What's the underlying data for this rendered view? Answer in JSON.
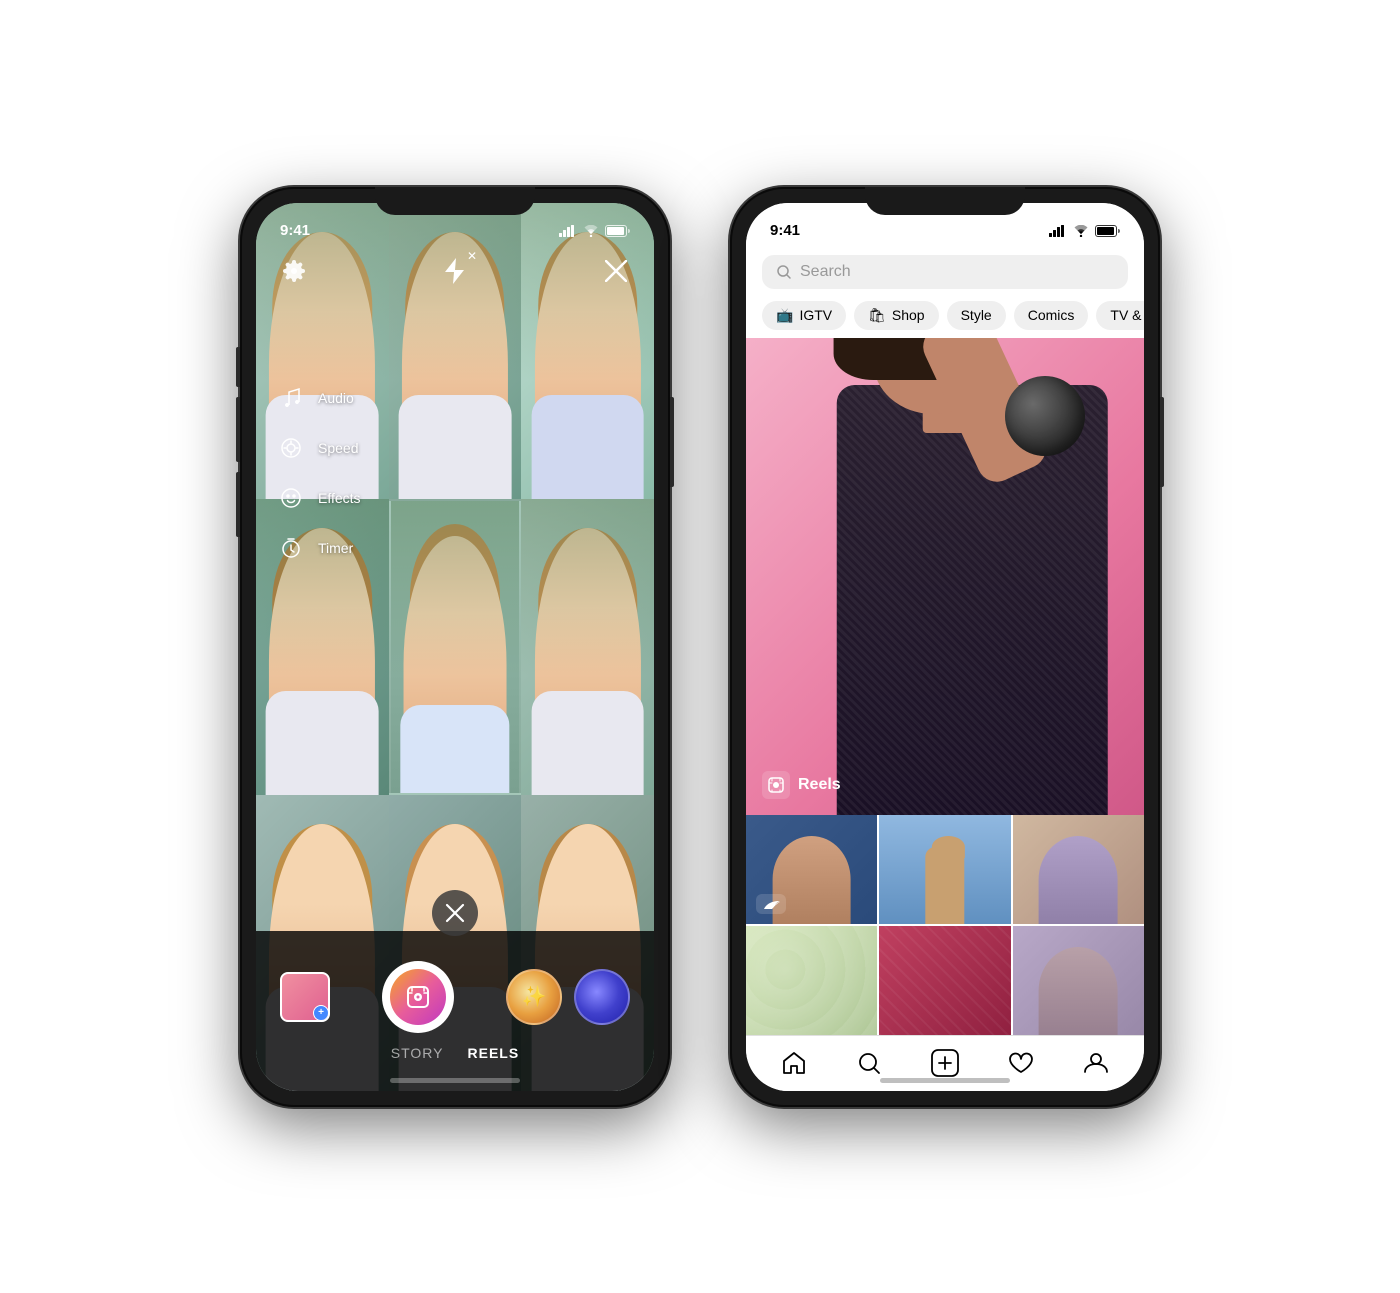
{
  "phones": {
    "left": {
      "status": {
        "time": "9:41"
      },
      "camera": {
        "menu_items": [
          {
            "icon": "music-icon",
            "label": "Audio"
          },
          {
            "icon": "speed-icon",
            "label": "Speed"
          },
          {
            "icon": "effects-icon",
            "label": "Effects"
          },
          {
            "icon": "timer-icon",
            "label": "Timer"
          }
        ],
        "modes": [
          "STORY",
          "REELS"
        ],
        "active_mode": "REELS"
      }
    },
    "right": {
      "status": {
        "time": "9:41"
      },
      "search": {
        "placeholder": "Search"
      },
      "categories": [
        {
          "icon": "📺",
          "label": "IGTV"
        },
        {
          "icon": "🛍",
          "label": "Shop"
        },
        {
          "icon": "",
          "label": "Style"
        },
        {
          "icon": "",
          "label": "Comics"
        },
        {
          "icon": "",
          "label": "TV & Movies"
        }
      ],
      "reels_label": "Reels",
      "bottom_nav": [
        {
          "icon": "home-icon",
          "label": "Home"
        },
        {
          "icon": "search-icon",
          "label": "Search"
        },
        {
          "icon": "add-icon",
          "label": "Add"
        },
        {
          "icon": "heart-icon",
          "label": "Activity"
        },
        {
          "icon": "profile-icon",
          "label": "Profile"
        }
      ]
    }
  }
}
